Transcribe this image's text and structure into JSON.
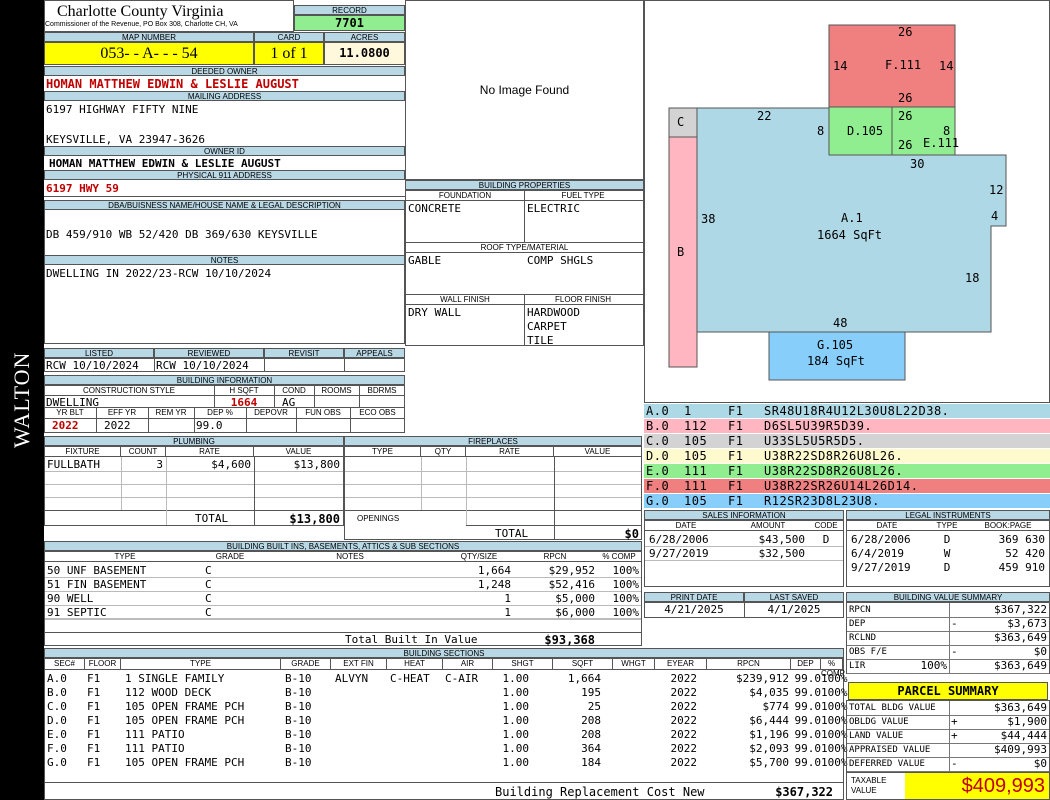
{
  "sidebar": {
    "district": "WALTON"
  },
  "header": {
    "county": "Charlotte County Virginia",
    "commissioner": "Commissioner of the Revenue, PO Box 308, Charlotte CH, VA",
    "record_label": "RECORD",
    "record": "7701",
    "map_label": "MAP NUMBER",
    "map_number": "053- - A- - - 54",
    "card_label": "CARD",
    "card": "1 of 1",
    "acres_label": "ACRES",
    "acres": "11.0800"
  },
  "owner": {
    "deeded_label": "DEEDED OWNER",
    "deeded": "HOMAN MATTHEW EDWIN & LESLIE AUGUST",
    "mailing_label": "MAILING ADDRESS",
    "mail1": "6197 HIGHWAY FIFTY NINE",
    "mail2": "KEYSVILLE, VA 23947-3626",
    "owner_id_label": "OWNER ID",
    "owner_id": "HOMAN MATTHEW EDWIN & LESLIE AUGUST",
    "phys_label": "PHYSICAL 911 ADDRESS",
    "phys": "6197 HWY 59",
    "dba_label": "DBA/BUISNESS NAME/HOUSE NAME & LEGAL DESCRIPTION",
    "legal": "DB 459/910 WB 52/420 DB 369/630 KEYSVILLE",
    "notes_label": "NOTES",
    "notes": "DWELLING IN 2022/23-RCW 10/10/2024"
  },
  "image": {
    "none": "No Image Found"
  },
  "building_props": {
    "title": "BUILDING PROPERTIES",
    "foundation_label": "FOUNDATION",
    "fuel_label": "FUEL TYPE",
    "foundation": "CONCRETE",
    "fuel": "ELECTRIC",
    "roof_label": "ROOF TYPE/MATERIAL",
    "roof_type": "GABLE",
    "roof_mat": "COMP SHGLS",
    "wall_label": "WALL FINISH",
    "floor_label": "FLOOR FINISH",
    "wall": "DRY WALL",
    "floors": [
      "HARDWOOD",
      "CARPET",
      "TILE"
    ]
  },
  "review": {
    "listed_label": "LISTED",
    "reviewed_label": "REVIEWED",
    "revisit_label": "REVISIT",
    "appeals_label": "APPEALS",
    "listed": "RCW 10/10/2024",
    "reviewed": "RCW 10/10/2024"
  },
  "building_info": {
    "title": "BUILDING INFORMATION",
    "style_label": "CONSTRUCTION STYLE",
    "hsqft_label": "H SQFT",
    "cond_label": "COND",
    "rooms_label": "ROOMS",
    "bdrms_label": "BDRMS",
    "style": "DWELLING",
    "hsqft": "1664",
    "cond": "AG",
    "yrblt_label": "YR BLT",
    "effyr_label": "EFF YR",
    "remyr_label": "REM YR",
    "dep_label": "DEP %",
    "depovr_label": "DEPOVR",
    "funobs_label": "FUN OBS",
    "ecoobs_label": "ECO OBS",
    "yrblt": "2022",
    "effyr": "2022",
    "dep": "99.0"
  },
  "plumbing": {
    "title": "PLUMBING",
    "cols": [
      "FIXTURE",
      "COUNT",
      "RATE",
      "VALUE"
    ],
    "rows": [
      [
        "FULLBATH",
        "3",
        "$4,600",
        "$13,800"
      ]
    ],
    "total_label": "TOTAL",
    "total": "$13,800"
  },
  "fireplaces": {
    "title": "FIREPLACES",
    "cols": [
      "TYPE",
      "QTY",
      "RATE",
      "VALUE"
    ],
    "openings_label": "OPENINGS",
    "total_label": "TOTAL",
    "total": "$0"
  },
  "builtins": {
    "title": "BUILDING BUILT INS, BASEMENTS, ATTICS & SUB SECTIONS",
    "cols": [
      "TYPE",
      "GRADE",
      "NOTES",
      "QTY/SIZE",
      "RPCN",
      "% COMP"
    ],
    "rows": [
      [
        "50 UNF BASEMENT",
        "C",
        "",
        "1,664",
        "$29,952",
        "100%"
      ],
      [
        "51 FIN BASEMENT",
        "C",
        "",
        "1,248",
        "$52,416",
        "100%"
      ],
      [
        "90 WELL",
        "C",
        "",
        "1",
        "$5,000",
        "100%"
      ],
      [
        "91 SEPTIC",
        "C",
        "",
        "1",
        "$6,000",
        "100%"
      ]
    ],
    "total_label": "Total Built In Value",
    "total": "$93,368"
  },
  "sections": {
    "title": "BUILDING SECTIONS",
    "cols": [
      "SEC#",
      "FLOOR",
      "TYPE",
      "GRADE",
      "EXT FIN",
      "HEAT",
      "AIR",
      "SHGT",
      "SQFT",
      "WHGT",
      "EYEAR",
      "RPCN",
      "DEP",
      "% COMP"
    ],
    "rows": [
      [
        "A.0",
        "F1",
        "1 SINGLE FAMILY",
        "B-10",
        "ALVYN",
        "C-HEAT",
        "C-AIR",
        "1.00",
        "1,664",
        "",
        "2022",
        "$239,912",
        "99.0",
        "100%"
      ],
      [
        "B.0",
        "F1",
        "112 WOOD DECK",
        "B-10",
        "",
        "",
        "",
        "1.00",
        "195",
        "",
        "2022",
        "$4,035",
        "99.0",
        "100%"
      ],
      [
        "C.0",
        "F1",
        "105 OPEN FRAME PCH",
        "B-10",
        "",
        "",
        "",
        "1.00",
        "25",
        "",
        "2022",
        "$774",
        "99.0",
        "100%"
      ],
      [
        "D.0",
        "F1",
        "105 OPEN FRAME PCH",
        "B-10",
        "",
        "",
        "",
        "1.00",
        "208",
        "",
        "2022",
        "$6,444",
        "99.0",
        "100%"
      ],
      [
        "E.0",
        "F1",
        "111 PATIO",
        "B-10",
        "",
        "",
        "",
        "1.00",
        "208",
        "",
        "2022",
        "$1,196",
        "99.0",
        "100%"
      ],
      [
        "F.0",
        "F1",
        "111 PATIO",
        "B-10",
        "",
        "",
        "",
        "1.00",
        "364",
        "",
        "2022",
        "$2,093",
        "99.0",
        "100%"
      ],
      [
        "G.0",
        "F1",
        "105 OPEN FRAME PCH",
        "B-10",
        "",
        "",
        "",
        "1.00",
        "184",
        "",
        "2022",
        "$5,700",
        "99.0",
        "100%"
      ]
    ],
    "brcn_label": "Building Replacement Cost New",
    "brcn": "$367,322"
  },
  "sketch": {
    "a_label": "A.1",
    "a_sqft": "1664 SqFt",
    "g_label": "G.105",
    "g_sqft": "184 SqFt",
    "f_label": "F.111",
    "d_label": "D.105",
    "e_label": "E.111",
    "b_label": "B",
    "c_label": "C",
    "dims": [
      "26",
      "14",
      "14",
      "26",
      "26",
      "22",
      "8",
      "8",
      "26",
      "30",
      "12",
      "4",
      "38",
      "18",
      "48"
    ],
    "colors": {
      "A": "#aed8e6",
      "B": "#ffb6c1",
      "C": "#d3d3d3",
      "D": "#90ee90",
      "E": "#90ee90",
      "F": "#f08080",
      "G": "#87cefa"
    }
  },
  "codes": [
    {
      "sec": "A.0",
      "code": "1",
      "fl": "F1",
      "desc": "SR48U18R4U12L30U8L22D38.",
      "color": "#add8e6"
    },
    {
      "sec": "B.0",
      "code": "112",
      "fl": "F1",
      "desc": "D6SL5U39R5D39.",
      "color": "#ffb6c1"
    },
    {
      "sec": "C.0",
      "code": "105",
      "fl": "F1",
      "desc": "U33SL5U5R5D5.",
      "color": "#d3d3d3"
    },
    {
      "sec": "D.0",
      "code": "105",
      "fl": "F1",
      "desc": "U38R22SD8R26U8L26.",
      "color": "#fffacd"
    },
    {
      "sec": "E.0",
      "code": "111",
      "fl": "F1",
      "desc": "U38R22SD8R26U8L26.",
      "color": "#90ee90"
    },
    {
      "sec": "F.0",
      "code": "111",
      "fl": "F1",
      "desc": "U38R22SR26U14L26D14.",
      "color": "#f08080"
    },
    {
      "sec": "G.0",
      "code": "105",
      "fl": "F1",
      "desc": "R12SR23D8L23U8.",
      "color": "#87cefa"
    }
  ],
  "sales": {
    "title": "SALES INFORMATION",
    "cols": [
      "DATE",
      "AMOUNT",
      "CODE"
    ],
    "rows": [
      [
        "6/28/2006",
        "$43,500",
        "D"
      ],
      [
        "9/27/2019",
        "$32,500",
        ""
      ]
    ]
  },
  "legal_instr": {
    "title": "LEGAL INSTRUMENTS",
    "cols": [
      "DATE",
      "TYPE",
      "BOOK:PAGE"
    ],
    "rows": [
      [
        "6/28/2006",
        "D",
        "369 630"
      ],
      [
        "6/4/2019",
        "W",
        "52 420"
      ],
      [
        "9/27/2019",
        "D",
        "459 910"
      ]
    ]
  },
  "print": {
    "print_label": "PRINT DATE",
    "saved_label": "LAST SAVED",
    "print_date": "4/21/2025",
    "last_saved": "4/1/2025"
  },
  "bvs": {
    "title": "BUILDING VALUE SUMMARY",
    "rows": [
      {
        "label": "RPCN",
        "op": "",
        "pct": "",
        "value": "$367,322"
      },
      {
        "label": "DEP",
        "op": "-",
        "pct": "",
        "value": "$3,673"
      },
      {
        "label": "RCLND",
        "op": "",
        "pct": "",
        "value": "$363,649"
      },
      {
        "label": "OBS F/E",
        "op": "-",
        "pct": "",
        "value": "$0"
      },
      {
        "label": "LIR",
        "op": "",
        "pct": "100%",
        "value": "$363,649"
      }
    ]
  },
  "parcel": {
    "title": "PARCEL SUMMARY",
    "rows": [
      {
        "label": "TOTAL BLDG VALUE",
        "op": "",
        "value": "$363,649"
      },
      {
        "label": "OBLDG VALUE",
        "op": "+",
        "value": "$1,900"
      },
      {
        "label": "LAND VALUE",
        "op": "+",
        "value": "$44,444"
      },
      {
        "label": "APPRAISED VALUE",
        "op": "",
        "value": "$409,993"
      },
      {
        "label": "DEFERRED VALUE",
        "op": "-",
        "value": "$0"
      }
    ],
    "taxable_label": "TAXABLE VALUE",
    "taxable": "$409,993"
  }
}
